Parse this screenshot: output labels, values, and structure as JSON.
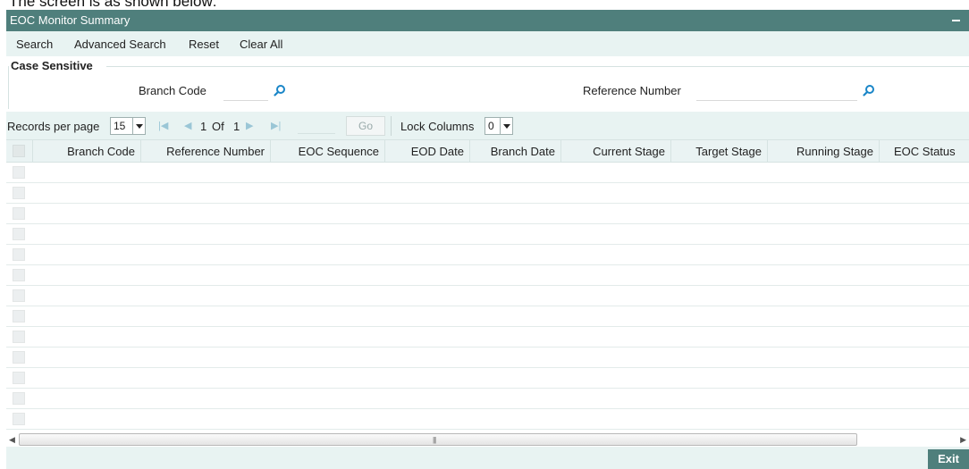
{
  "caption": "The screen is as shown below:",
  "window": {
    "title": "EOC Monitor Summary"
  },
  "menu": {
    "search": "Search",
    "advanced_search": "Advanced Search",
    "reset": "Reset",
    "clear_all": "Clear All"
  },
  "criteria": {
    "legend": "Case Sensitive",
    "branch_code_label": "Branch Code",
    "branch_code_value": "",
    "reference_number_label": "Reference Number",
    "reference_number_value": ""
  },
  "pager": {
    "records_per_page_label": "Records per page",
    "records_per_page_value": "15",
    "current_page": "1",
    "of_label": "Of",
    "total_pages": "1",
    "go_label": "Go",
    "lock_columns_label": "Lock Columns",
    "lock_columns_value": "0"
  },
  "table": {
    "columns": [
      "Branch Code",
      "Reference Number",
      "EOC Sequence",
      "EOD Date",
      "Branch Date",
      "Current Stage",
      "Target Stage",
      "Running Stage",
      "EOC Status"
    ],
    "rows": []
  },
  "footer": {
    "exit_label": "Exit"
  },
  "colors": {
    "header_bar": "#4f7f7c",
    "panel_bg": "#e8f3f2",
    "icon_blue": "#1a86c8"
  }
}
